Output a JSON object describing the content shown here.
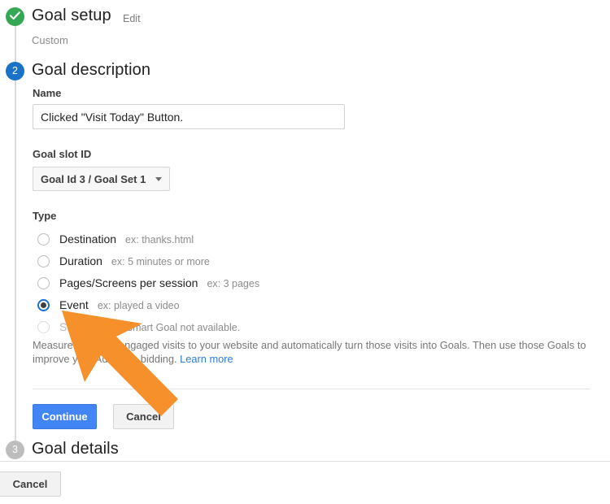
{
  "stepper": {
    "step1": {
      "number": "",
      "title": "Goal setup",
      "edit_label": "Edit",
      "sub_label": "Custom",
      "state": "done"
    },
    "step2": {
      "number": "2",
      "title": "Goal description",
      "state": "active"
    },
    "step3": {
      "number": "3",
      "title": "Goal details",
      "state": "idle"
    }
  },
  "form": {
    "name_label": "Name",
    "name_value": "Clicked \"Visit Today\" Button.",
    "slot_label": "Goal slot ID",
    "slot_value": "Goal Id 3 / Goal Set 1",
    "type_label": "Type",
    "options": [
      {
        "label": "Destination",
        "example": "ex: thanks.html",
        "checked": false,
        "disabled": false
      },
      {
        "label": "Duration",
        "example": "ex: 5 minutes or more",
        "checked": false,
        "disabled": false
      },
      {
        "label": "Pages/Screens per session",
        "example": "ex: 3 pages",
        "checked": false,
        "disabled": false
      },
      {
        "label": "Event",
        "example": "ex: played a video",
        "checked": true,
        "disabled": false
      },
      {
        "label": "Smart Goal",
        "example": "Smart Goal not available.",
        "checked": false,
        "disabled": true
      }
    ],
    "smart_goal_description": "Measure the most engaged visits to your website and automatically turn those visits into Goals. Then use those Goals to improve your AdWords bidding. ",
    "learn_more_label": "Learn more"
  },
  "actions": {
    "continue_label": "Continue",
    "cancel_label": "Cancel",
    "footer_cancel_label": "Cancel"
  },
  "colors": {
    "done_green": "#34a853",
    "active_blue": "#1a73c8",
    "idle_gray": "#bdbdbd",
    "primary_button": "#4285f4",
    "link_blue": "#2b7de0",
    "arrow_orange": "#f5902b"
  }
}
